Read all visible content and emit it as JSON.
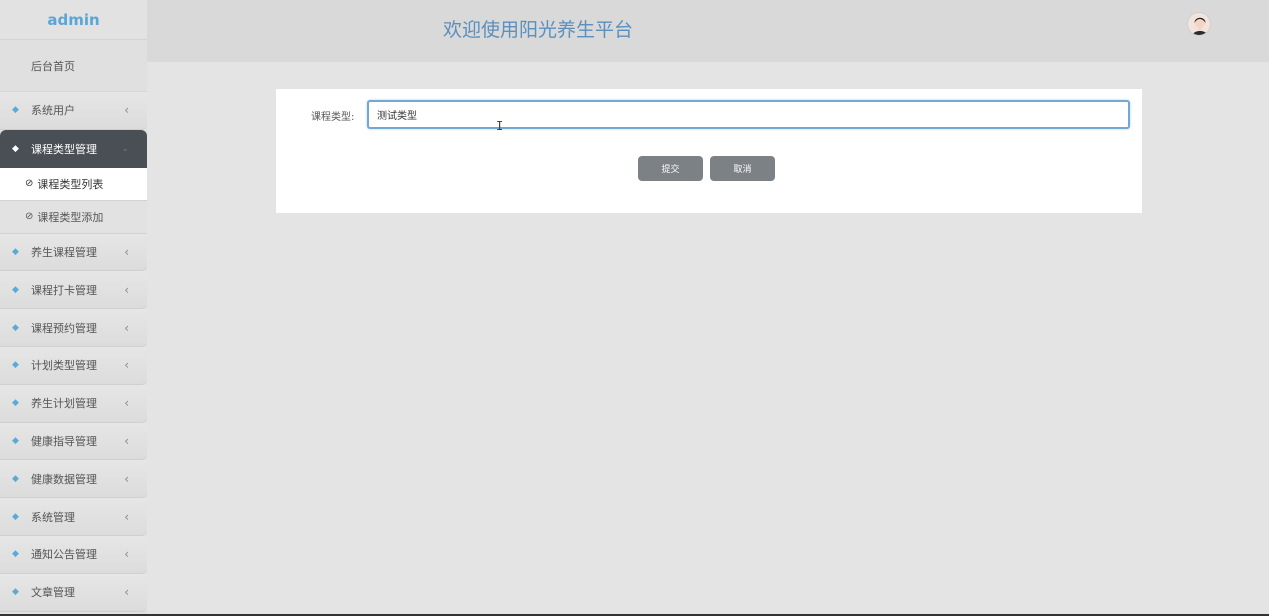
{
  "sidebar": {
    "brand": "admin",
    "home": "后台首页",
    "menu_before": [
      {
        "label": "系统用户"
      }
    ],
    "active_menu": {
      "label": "课程类型管理"
    },
    "sub_items": [
      {
        "label": "课程类型列表"
      },
      {
        "label": "课程类型添加"
      }
    ],
    "menu_after": [
      {
        "label": "养生课程管理"
      },
      {
        "label": "课程打卡管理"
      },
      {
        "label": "课程预约管理"
      },
      {
        "label": "计划类型管理"
      },
      {
        "label": "养生计划管理"
      },
      {
        "label": "健康指导管理"
      },
      {
        "label": "健康数据管理"
      },
      {
        "label": "系统管理"
      },
      {
        "label": "通知公告管理"
      },
      {
        "label": "文章管理"
      }
    ]
  },
  "header": {
    "title": "欢迎使用阳光养生平台"
  },
  "form": {
    "field_label": "课程类型:",
    "field_value": "测试类型",
    "submit_label": "提交",
    "cancel_label": "取消"
  },
  "icons": {
    "menu_icon": "diamond-icon",
    "sub_icon": "clock-icon",
    "chevron": "chevron-left-icon"
  },
  "colors": {
    "brand": "#5aa6d6",
    "title": "#5b8fbd",
    "active_menu_bg": "#4a4f55",
    "button_bg": "#7c8186",
    "input_border": "#74a8d4"
  }
}
